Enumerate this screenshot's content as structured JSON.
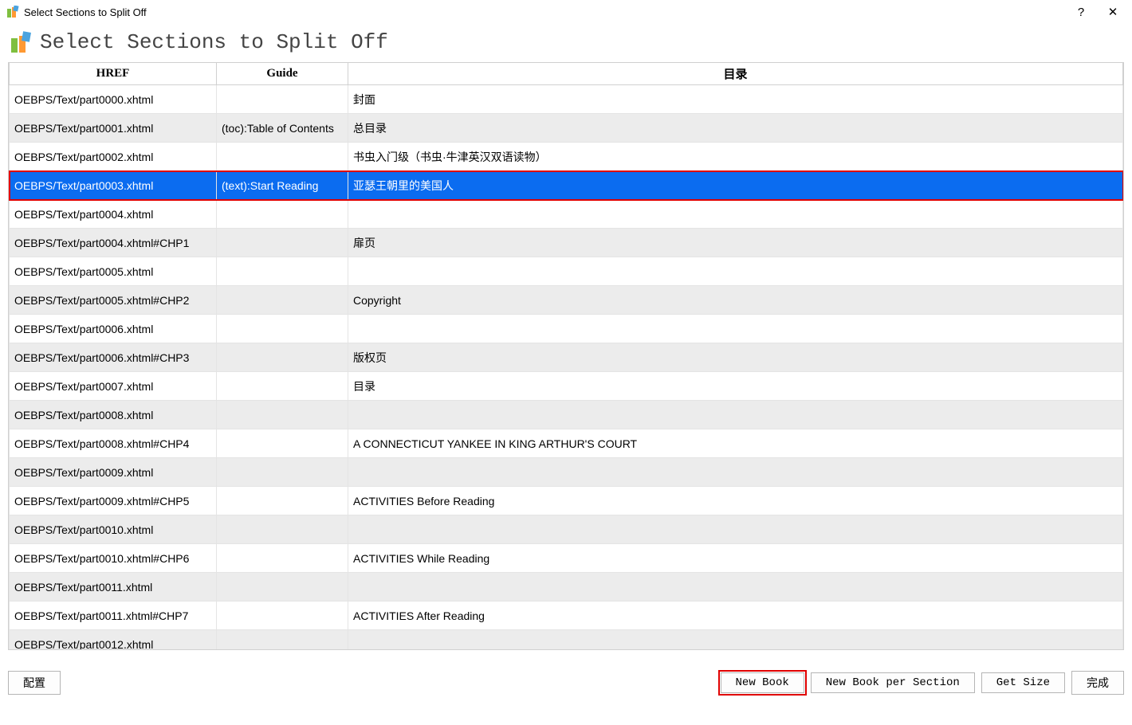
{
  "window": {
    "title": "Select Sections to Split Off",
    "help_symbol": "?",
    "close_symbol": "✕"
  },
  "header": {
    "title": "Select Sections to Split Off"
  },
  "table": {
    "cols": {
      "href": "HREF",
      "guide": "Guide",
      "toc": "目录"
    },
    "rows": [
      {
        "href": "OEBPS/Text/part0000.xhtml",
        "guide": "",
        "toc": "封面",
        "alt": false
      },
      {
        "href": "OEBPS/Text/part0001.xhtml",
        "guide": "(toc):Table of Contents",
        "toc": "总目录",
        "alt": true
      },
      {
        "href": "OEBPS/Text/part0002.xhtml",
        "guide": "",
        "toc": "书虫入门级（书虫·牛津英汉双语读物）",
        "alt": false
      },
      {
        "href": "OEBPS/Text/part0003.xhtml",
        "guide": "(text):Start Reading",
        "toc": "亚瑟王朝里的美国人",
        "alt": true,
        "selected": true,
        "red": true
      },
      {
        "href": "OEBPS/Text/part0004.xhtml",
        "guide": "",
        "toc": "",
        "alt": false
      },
      {
        "href": "OEBPS/Text/part0004.xhtml#CHP1",
        "guide": "",
        "toc": "扉页",
        "alt": true
      },
      {
        "href": "OEBPS/Text/part0005.xhtml",
        "guide": "",
        "toc": "",
        "alt": false
      },
      {
        "href": "OEBPS/Text/part0005.xhtml#CHP2",
        "guide": "",
        "toc": "Copyright",
        "alt": true
      },
      {
        "href": "OEBPS/Text/part0006.xhtml",
        "guide": "",
        "toc": "",
        "alt": false
      },
      {
        "href": "OEBPS/Text/part0006.xhtml#CHP3",
        "guide": "",
        "toc": "版权页",
        "alt": true
      },
      {
        "href": "OEBPS/Text/part0007.xhtml",
        "guide": "",
        "toc": "目录",
        "alt": false
      },
      {
        "href": "OEBPS/Text/part0008.xhtml",
        "guide": "",
        "toc": "",
        "alt": true
      },
      {
        "href": "OEBPS/Text/part0008.xhtml#CHP4",
        "guide": "",
        "toc": "A CONNECTICUT YANKEE IN KING ARTHUR'S COURT",
        "alt": false
      },
      {
        "href": "OEBPS/Text/part0009.xhtml",
        "guide": "",
        "toc": "",
        "alt": true
      },
      {
        "href": "OEBPS/Text/part0009.xhtml#CHP5",
        "guide": "",
        "toc": "ACTIVITIES Before Reading",
        "alt": false
      },
      {
        "href": "OEBPS/Text/part0010.xhtml",
        "guide": "",
        "toc": "",
        "alt": true
      },
      {
        "href": "OEBPS/Text/part0010.xhtml#CHP6",
        "guide": "",
        "toc": "ACTIVITIES While Reading",
        "alt": false
      },
      {
        "href": "OEBPS/Text/part0011.xhtml",
        "guide": "",
        "toc": "",
        "alt": true
      },
      {
        "href": "OEBPS/Text/part0011.xhtml#CHP7",
        "guide": "",
        "toc": "ACTIVITIES After Reading",
        "alt": false
      },
      {
        "href": "OEBPS/Text/part0012.xhtml",
        "guide": "",
        "toc": "",
        "alt": true
      }
    ]
  },
  "footer": {
    "config": "配置",
    "new_book": "New Book",
    "new_book_per_section": "New Book per Section",
    "get_size": "Get Size",
    "done": "完成"
  }
}
